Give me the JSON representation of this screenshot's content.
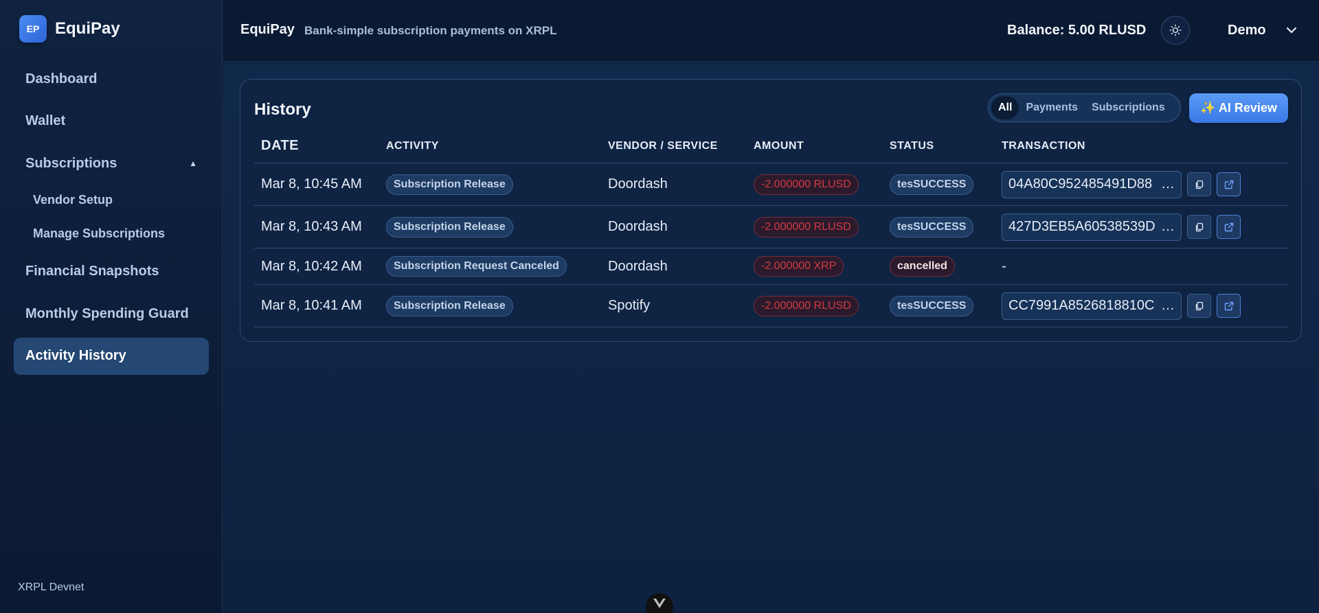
{
  "brand": {
    "logo": "EP",
    "name": "EquiPay"
  },
  "sidebar": {
    "items": [
      {
        "label": "Dashboard"
      },
      {
        "label": "Wallet"
      },
      {
        "label": "Subscriptions",
        "caret": "▲"
      },
      {
        "label": "Financial Snapshots"
      },
      {
        "label": "Monthly Spending Guard"
      },
      {
        "label": "Activity History"
      }
    ],
    "subitems": [
      {
        "label": "Vendor Setup"
      },
      {
        "label": "Manage Subscriptions"
      }
    ],
    "network": "XRPL Devnet"
  },
  "topbar": {
    "title": "EquiPay",
    "subtitle": "Bank-simple subscription payments on XRPL",
    "balance": "Balance: 5.00 RLUSD",
    "theme_icon": "sun-icon",
    "user": "Demo"
  },
  "history": {
    "title": "History",
    "filters": [
      {
        "label": "All"
      },
      {
        "label": "Payments"
      },
      {
        "label": "Subscriptions"
      }
    ],
    "ai_button": "✨ AI Review",
    "columns": [
      "DATE",
      "ACTIVITY",
      "VENDOR / SERVICE",
      "AMOUNT",
      "STATUS",
      "TRANSACTION"
    ],
    "rows": [
      {
        "date": "Mar 8, 10:45 AM",
        "activity": "Subscription Release",
        "vendor": "Doordash",
        "amount": "-2.000000 RLUSD",
        "status": "tesSUCCESS",
        "tx": "04A80C952485491D88",
        "ellipsis": "…"
      },
      {
        "date": "Mar 8, 10:43 AM",
        "activity": "Subscription Release",
        "vendor": "Doordash",
        "amount": "-2.000000 RLUSD",
        "status": "tesSUCCESS",
        "tx": "427D3EB5A60538539D",
        "ellipsis": "…"
      },
      {
        "date": "Mar 8, 10:42 AM",
        "activity": "Subscription Request Canceled",
        "vendor": "Doordash",
        "amount": "-2.000000 XRP",
        "status": "cancelled",
        "tx": "-",
        "ellipsis": ""
      },
      {
        "date": "Mar 8, 10:41 AM",
        "activity": "Subscription Release",
        "vendor": "Spotify",
        "amount": "-2.000000 RLUSD",
        "status": "tesSUCCESS",
        "tx": "CC7991A8526818810C",
        "ellipsis": "…"
      }
    ]
  },
  "colors": {
    "accent": "#3a78e6",
    "danger": "#d43a43",
    "bg": "#0d1b33"
  }
}
